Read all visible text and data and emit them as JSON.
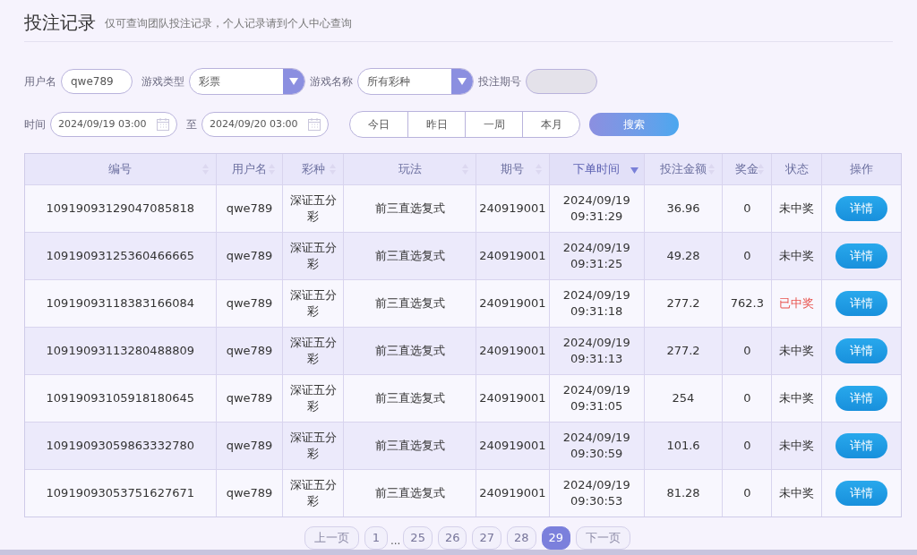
{
  "title": "投注记录",
  "subtitle": "仅可查询团队投注记录，个人记录请到个人中心查询",
  "filters": {
    "username_label": "用户名",
    "username": "qwe789",
    "game_type_label": "游戏类型",
    "game_type": "彩票",
    "game_name_label": "游戏名称",
    "game_name": "所有彩种",
    "issue_label": "投注期号",
    "time_label": "时间",
    "start": "2024/09/19 03:00",
    "to_label": "至",
    "end": "2024/09/20 03:00",
    "quick": [
      "今日",
      "昨日",
      "一周",
      "本月"
    ],
    "search": "搜索"
  },
  "table": {
    "columns": [
      {
        "label": "编号",
        "sortable": true,
        "sorted": false
      },
      {
        "label": "用户名",
        "sortable": true,
        "sorted": false
      },
      {
        "label": "彩种",
        "sortable": true,
        "sorted": false
      },
      {
        "label": "玩法",
        "sortable": true,
        "sorted": false
      },
      {
        "label": "期号",
        "sortable": true,
        "sorted": false
      },
      {
        "label": "下单时间",
        "sortable": true,
        "sorted": true
      },
      {
        "label": "投注金额",
        "sortable": true,
        "sorted": false
      },
      {
        "label": "奖金",
        "sortable": true,
        "sorted": false
      },
      {
        "label": "状态",
        "sortable": false,
        "sorted": false
      },
      {
        "label": "操作",
        "sortable": false,
        "sorted": false
      }
    ],
    "rows": [
      {
        "id": "10919093129047085818",
        "user": "qwe789",
        "lottery": "深证五分彩",
        "play": "前三直选复式",
        "issue": "240919001",
        "date": "2024/09/19",
        "time": "09:31:29",
        "amount": "36.96",
        "prize": "0",
        "status": "未中奖",
        "won": false,
        "action": "详情"
      },
      {
        "id": "10919093125360466665",
        "user": "qwe789",
        "lottery": "深证五分彩",
        "play": "前三直选复式",
        "issue": "240919001",
        "date": "2024/09/19",
        "time": "09:31:25",
        "amount": "49.28",
        "prize": "0",
        "status": "未中奖",
        "won": false,
        "action": "详情"
      },
      {
        "id": "10919093118383166084",
        "user": "qwe789",
        "lottery": "深证五分彩",
        "play": "前三直选复式",
        "issue": "240919001",
        "date": "2024/09/19",
        "time": "09:31:18",
        "amount": "277.2",
        "prize": "762.3",
        "status": "已中奖",
        "won": true,
        "action": "详情"
      },
      {
        "id": "10919093113280488809",
        "user": "qwe789",
        "lottery": "深证五分彩",
        "play": "前三直选复式",
        "issue": "240919001",
        "date": "2024/09/19",
        "time": "09:31:13",
        "amount": "277.2",
        "prize": "0",
        "status": "未中奖",
        "won": false,
        "action": "详情"
      },
      {
        "id": "10919093105918180645",
        "user": "qwe789",
        "lottery": "深证五分彩",
        "play": "前三直选复式",
        "issue": "240919001",
        "date": "2024/09/19",
        "time": "09:31:05",
        "amount": "254",
        "prize": "0",
        "status": "未中奖",
        "won": false,
        "action": "详情"
      },
      {
        "id": "10919093059863332780",
        "user": "qwe789",
        "lottery": "深证五分彩",
        "play": "前三直选复式",
        "issue": "240919001",
        "date": "2024/09/19",
        "time": "09:30:59",
        "amount": "101.6",
        "prize": "0",
        "status": "未中奖",
        "won": false,
        "action": "详情"
      },
      {
        "id": "10919093053751627671",
        "user": "qwe789",
        "lottery": "深证五分彩",
        "play": "前三直选复式",
        "issue": "240919001",
        "date": "2024/09/19",
        "time": "09:30:53",
        "amount": "81.28",
        "prize": "0",
        "status": "未中奖",
        "won": false,
        "action": "详情"
      }
    ]
  },
  "pagination": [
    {
      "kind": "button",
      "label": "上一页",
      "disabled": true
    },
    {
      "kind": "page",
      "label": "1",
      "selected": false
    },
    {
      "kind": "gap",
      "label": "..."
    },
    {
      "kind": "page",
      "label": "25",
      "selected": false
    },
    {
      "kind": "page",
      "label": "26",
      "selected": false
    },
    {
      "kind": "page",
      "label": "27",
      "selected": false
    },
    {
      "kind": "page",
      "label": "28",
      "selected": false
    },
    {
      "kind": "page",
      "label": "29",
      "selected": true
    },
    {
      "kind": "button",
      "label": "下一页",
      "disabled": true
    }
  ]
}
